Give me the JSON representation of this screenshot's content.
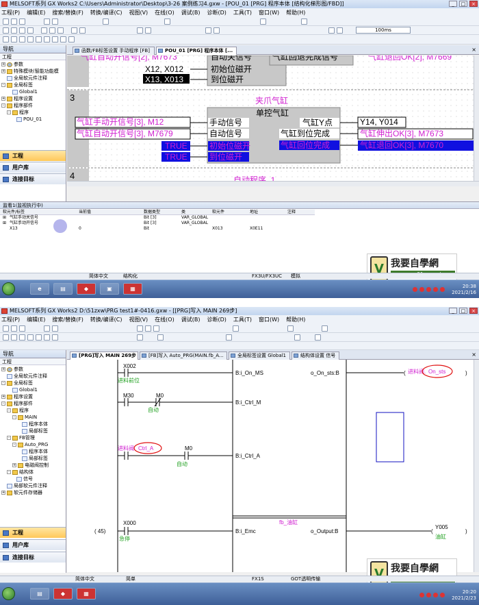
{
  "s1": {
    "title": "MELSOFT系列 GX Works2 C:\\Users\\Administrator\\Desktop\\3-26 案例练习4.gxw - [POU_01 [PRG] 程序本体 [结构化梯形图/FBD]]",
    "menu": [
      "工程(P)",
      "编辑(E)",
      "搜索/替换(F)",
      "转换/编译(C)",
      "视图(V)",
      "在线(O)",
      "调试(B)",
      "诊断(D)",
      "工具(T)",
      "窗口(W)",
      "帮助(H)"
    ],
    "interval": "100ms",
    "nav_title": "导航",
    "nav_sub": "工程",
    "tree": [
      "参数",
      "特殊模块(智能功能模",
      "全局软元件注释",
      "全局标签",
      "Global1",
      "程序设置",
      "程序部件",
      "程序",
      "POU_01"
    ],
    "nav_buttons": [
      "工程",
      "用户库",
      "连接目标"
    ],
    "tabs": [
      "函数/FB标签设置 手动程序 [FB]",
      "POU_01 [PRG] 程序本体 [..."
    ],
    "rung_top": {
      "l1": "气缸自动开信号[2], M7673",
      "l2": "自动关信号",
      "l3": "气缸回退完成信号",
      "l4": "气缸退回OK[2], M7669",
      "r1": "X12, X012",
      "r1b": "初始位磁开",
      "r2": "X13, X013",
      "r2b": "到位磁开"
    },
    "rung3": {
      "num": "3",
      "fb_inst": "夹爪气缸",
      "fb_type": "单控气缸",
      "in1_var": "气缸手动开信号[3], M12",
      "in1_pin": "手动信号",
      "in2_var": "气缸自动开信号[3], M7679",
      "in2_pin": "自动信号",
      "in3_var": "TRUE",
      "in3_pin": "初始位磁开",
      "in4_var": "TRUE",
      "in4_pin": "到位磁开",
      "out1_pin": "气缸Y点",
      "out1_var": "Y14, Y014",
      "out2_pin": "气缸到位完成",
      "out2_var": "气缸伸出OK[3], M7673",
      "out3_pin": "气缸回位完成",
      "out3_var": "气缸退回OK[3], M7670"
    },
    "rung4": {
      "num": "4",
      "label": "自动程序_1",
      "sub": "自动程序"
    },
    "monitor": {
      "title": "监看1(监视执行中)",
      "headers": [
        "软元件/标签",
        "当前值",
        "数据类型",
        "类",
        "软元件",
        "地址",
        "注释"
      ],
      "rows": [
        [
          "气缸手动关信号",
          "",
          "Bit [3]",
          "VAR_GLOBAL",
          "",
          "",
          ""
        ],
        [
          "气缸手动开信号",
          "",
          "Bit [3]",
          "VAR_GLOBAL",
          "",
          "",
          ""
        ],
        [
          "X13",
          "0",
          "Bit",
          "",
          "X013",
          "X0E11",
          ""
        ]
      ]
    },
    "status": {
      "lang": "简体中文",
      "mode": "结构化",
      "cpu": "FX3U/FX3UC",
      "sim": "模拟"
    },
    "tray": {
      "time": "20:38",
      "date": "2021/2/16"
    }
  },
  "s2": {
    "title": "MELSOFT系列 GX Works2 D:\\51zxw\\PRG  test1#-0416.gxw - [[PRG]写入 MAIN 269步]",
    "menu": [
      "工程(P)",
      "编辑(E)",
      "搜索/替换(F)",
      "转换/编译(C)",
      "视图(V)",
      "在线(O)",
      "调试(B)",
      "诊断(D)",
      "工具(T)",
      "窗口(W)",
      "帮助(H)"
    ],
    "nav_title": "导航",
    "nav_sub": "工程",
    "tree": [
      "参数",
      "全局软元件注释",
      "全局标签",
      "Global1",
      "程序设置",
      "程序部件",
      "程序",
      "MAIN",
      "程序本体",
      "局部标签",
      "FB管理",
      "Auto_PRG",
      "程序本体",
      "局部标签",
      "电磁阀控制",
      "结构体",
      "信号",
      "局部软元件注释",
      "软元件存储器"
    ],
    "nav_buttons": [
      "工程",
      "用户库",
      "连接目标"
    ],
    "tabs": [
      "[PRG]写入 MAIN 269步",
      "[FB]写入 Auto_PRG(MAIN.fb_A...",
      "全局标签设置 Global1",
      "结构体设置 信号"
    ],
    "ladder": {
      "x002": "X002",
      "x002c": "进料前位",
      "b_on_ms": "B:i_On_MS",
      "o_on_sts": "o_On_sts:B",
      "coil1a": "进料阀.",
      "coil1b": "On_sts",
      "m30": "M30",
      "m0": "M0",
      "auto1": "自动",
      "b_ctrl_m": "B:i_Ctrl_M",
      "ctrl_a1": "进料阀.",
      "ctrl_a2": "Ctrl_A",
      "m0b": "M0",
      "auto2": "自动",
      "b_ctrl_a": "B:i_Ctrl_A",
      "step": "( 45)",
      "x000": "X000",
      "stop": "急停",
      "fb_name": "fb_油缸",
      "b_emc": "B:i_Emc",
      "o_output": "o_Output:B",
      "y005": "Y005",
      "y005c": "油缸"
    },
    "status": {
      "lang": "简体中文",
      "mode": "简单",
      "cpu": "FX1S",
      "got": "GOT透明传输"
    },
    "tray": {
      "time": "20:20",
      "date": "2021/2/23"
    }
  },
  "logo": {
    "text": "我要自學網",
    "url": "www.51zxw.net"
  }
}
